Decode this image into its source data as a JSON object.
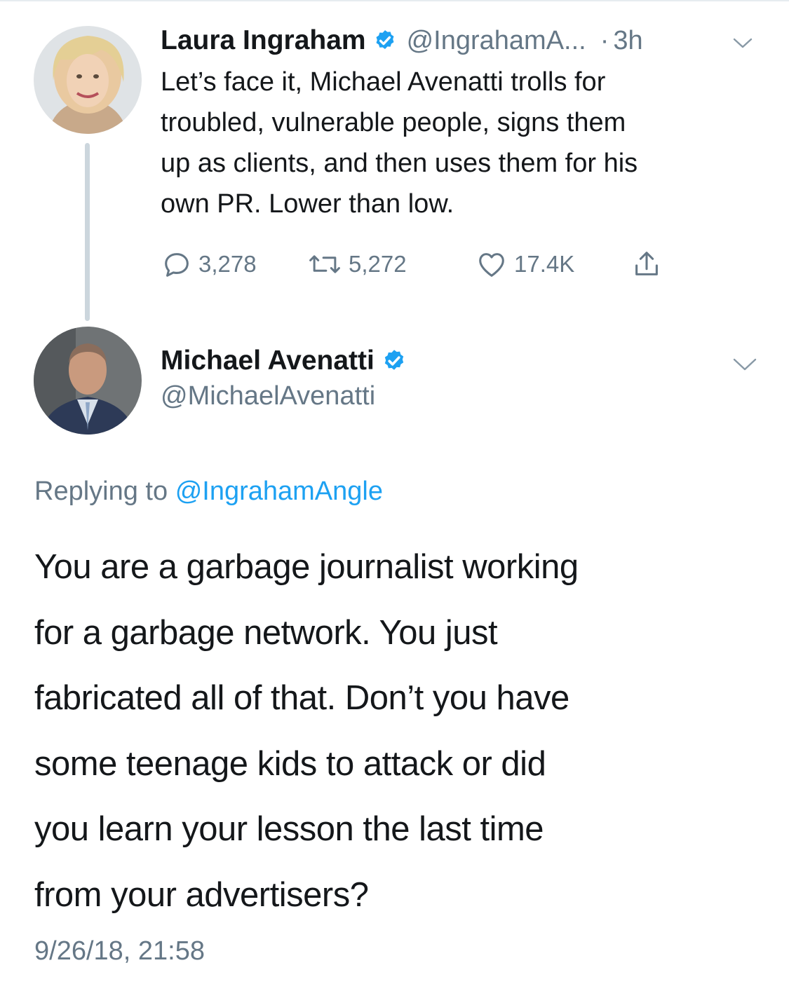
{
  "parent_tweet": {
    "author_name": "Laura Ingraham",
    "handle": "@IngrahamA...",
    "separator": "·",
    "time": "3h",
    "text": "Let’s face it, Michael Avenatti trolls for\ntroubled, vulnerable people, signs them\nup as clients, and then uses them for his\nown PR.  Lower than low.",
    "reply_count": "3,278",
    "retweet_count": "5,272",
    "like_count": "17.4K"
  },
  "reply_tweet": {
    "author_name": "Michael Avenatti",
    "handle": "@MichaelAvenatti",
    "replying_prefix": "Replying to",
    "replying_to": "@IngrahamAngle",
    "lines": [
      "You are a garbage journalist working",
      "for a garbage network. You just",
      "fabricated all of that. Don’t you have",
      "some teenage kids to attack or did",
      "you learn your lesson the last time",
      "from your advertisers?"
    ],
    "timestamp": "9/26/18, 21:58"
  },
  "icons": {
    "verified": "verified-badge-icon",
    "caret": "chevron-down-icon",
    "reply": "reply-icon",
    "retweet": "retweet-icon",
    "like": "heart-icon",
    "share": "share-icon"
  },
  "colors": {
    "text": "#14171a",
    "secondary": "#657786",
    "link": "#1da1f2",
    "verified": "#1da1f2",
    "thread_line": "#ccd6dd"
  }
}
